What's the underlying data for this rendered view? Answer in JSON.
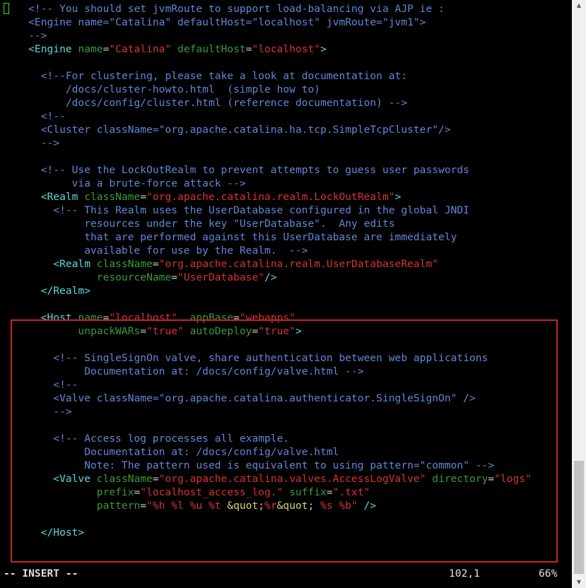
{
  "editor": {
    "lines": [
      [
        {
          "t": "    <!-- You should set jvmRoute to support load-balancing via AJP ie :",
          "c": "comment"
        }
      ],
      [
        {
          "t": "    <Engine name=\"Catalina\" defaultHost=\"localhost\" jvmRoute=\"jvm1\">",
          "c": "comment"
        }
      ],
      [
        {
          "t": "    -->",
          "c": "comment"
        }
      ],
      [
        {
          "t": "    <Engine",
          "c": "tag"
        },
        {
          "t": " name",
          "c": "attr"
        },
        {
          "t": "=",
          "c": "plain"
        },
        {
          "t": "\"Catalina\"",
          "c": "str"
        },
        {
          "t": " defaultHost",
          "c": "attr"
        },
        {
          "t": "=",
          "c": "plain"
        },
        {
          "t": "\"localhost\"",
          "c": "str"
        },
        {
          "t": ">",
          "c": "tag"
        }
      ],
      [
        {
          "t": "",
          "c": "plain"
        }
      ],
      [
        {
          "t": "      <!--For clustering, please take a look at documentation at:",
          "c": "comment"
        }
      ],
      [
        {
          "t": "          /docs/cluster-howto.html  (simple how to)",
          "c": "comment"
        }
      ],
      [
        {
          "t": "          /docs/config/cluster.html (reference documentation) -->",
          "c": "comment"
        }
      ],
      [
        {
          "t": "      <!--",
          "c": "comment"
        }
      ],
      [
        {
          "t": "      <Cluster className=\"org.apache.catalina.ha.tcp.SimpleTcpCluster\"/>",
          "c": "comment"
        }
      ],
      [
        {
          "t": "      -->",
          "c": "comment"
        }
      ],
      [
        {
          "t": "",
          "c": "plain"
        }
      ],
      [
        {
          "t": "      <!-- Use the LockOutRealm to prevent attempts to guess user passwords",
          "c": "comment"
        }
      ],
      [
        {
          "t": "           via a brute-force attack -->",
          "c": "comment"
        }
      ],
      [
        {
          "t": "      <Realm",
          "c": "tag"
        },
        {
          "t": " className",
          "c": "attr"
        },
        {
          "t": "=",
          "c": "plain"
        },
        {
          "t": "\"org.apache.catalina.realm.LockOutRealm\"",
          "c": "str"
        },
        {
          "t": ">",
          "c": "tag"
        }
      ],
      [
        {
          "t": "        <!-- This Realm uses the UserDatabase configured in the global JNDI",
          "c": "comment"
        }
      ],
      [
        {
          "t": "             resources under the key \"UserDatabase\".  Any edits",
          "c": "comment"
        }
      ],
      [
        {
          "t": "             that are performed against this UserDatabase are immediately",
          "c": "comment"
        }
      ],
      [
        {
          "t": "             available for use by the Realm.  -->",
          "c": "comment"
        }
      ],
      [
        {
          "t": "        <Realm",
          "c": "tag"
        },
        {
          "t": " className",
          "c": "attr"
        },
        {
          "t": "=",
          "c": "plain"
        },
        {
          "t": "\"org.apache.catalina.realm.UserDatabaseRealm\"",
          "c": "str"
        }
      ],
      [
        {
          "t": "               resourceName",
          "c": "attr"
        },
        {
          "t": "=",
          "c": "plain"
        },
        {
          "t": "\"UserDatabase\"",
          "c": "str"
        },
        {
          "t": "/>",
          "c": "tag"
        }
      ],
      [
        {
          "t": "      </Realm>",
          "c": "tag"
        }
      ],
      [
        {
          "t": "",
          "c": "plain"
        }
      ],
      [
        {
          "t": "      <Host",
          "c": "tag"
        },
        {
          "t": " name",
          "c": "attr"
        },
        {
          "t": "=",
          "c": "plain"
        },
        {
          "t": "\"localhost\"",
          "c": "str"
        },
        {
          "t": "  appBase",
          "c": "attr"
        },
        {
          "t": "=",
          "c": "plain"
        },
        {
          "t": "\"webapps\"",
          "c": "str"
        }
      ],
      [
        {
          "t": "            unpackWARs",
          "c": "attr"
        },
        {
          "t": "=",
          "c": "plain"
        },
        {
          "t": "\"true\"",
          "c": "str"
        },
        {
          "t": " autoDeploy",
          "c": "attr"
        },
        {
          "t": "=",
          "c": "plain"
        },
        {
          "t": "\"true\"",
          "c": "str"
        },
        {
          "t": ">",
          "c": "tag"
        }
      ],
      [
        {
          "t": "",
          "c": "plain"
        }
      ],
      [
        {
          "t": "        <!-- SingleSignOn valve, share authentication between web applications",
          "c": "comment"
        }
      ],
      [
        {
          "t": "             Documentation at: /docs/config/valve.html -->",
          "c": "comment"
        }
      ],
      [
        {
          "t": "        <!--",
          "c": "comment"
        }
      ],
      [
        {
          "t": "        <Valve className=\"org.apache.catalina.authenticator.SingleSignOn\" />",
          "c": "comment"
        }
      ],
      [
        {
          "t": "        -->",
          "c": "comment"
        }
      ],
      [
        {
          "t": "",
          "c": "plain"
        }
      ],
      [
        {
          "t": "        <!-- Access log processes all example.",
          "c": "comment"
        }
      ],
      [
        {
          "t": "             Documentation at: /docs/config/valve.html",
          "c": "comment"
        }
      ],
      [
        {
          "t": "             Note: The pattern used is equivalent to using pattern=\"common\" -->",
          "c": "comment"
        }
      ],
      [
        {
          "t": "        <Valve",
          "c": "tag"
        },
        {
          "t": " className",
          "c": "attr"
        },
        {
          "t": "=",
          "c": "plain"
        },
        {
          "t": "\"org.apache.catalina.valves.AccessLogValve\"",
          "c": "str"
        },
        {
          "t": " directory",
          "c": "attr"
        },
        {
          "t": "=",
          "c": "plain"
        },
        {
          "t": "\"logs\"",
          "c": "str"
        }
      ],
      [
        {
          "t": "               prefix",
          "c": "attr"
        },
        {
          "t": "=",
          "c": "plain"
        },
        {
          "t": "\"localhost_access_log.\"",
          "c": "str"
        },
        {
          "t": " suffix",
          "c": "attr"
        },
        {
          "t": "=",
          "c": "plain"
        },
        {
          "t": "\".txt\"",
          "c": "str"
        }
      ],
      [
        {
          "t": "               pattern",
          "c": "attr"
        },
        {
          "t": "=",
          "c": "plain"
        },
        {
          "t": "\"%h %l %u %t ",
          "c": "str"
        },
        {
          "t": "&quot;",
          "c": "ent"
        },
        {
          "t": "%r",
          "c": "str"
        },
        {
          "t": "&quot;",
          "c": "ent"
        },
        {
          "t": " %s %b\"",
          "c": "str"
        },
        {
          "t": " />",
          "c": "tag"
        }
      ],
      [
        {
          "t": "",
          "c": "plain"
        }
      ],
      [
        {
          "t": "      </Host>",
          "c": "tag"
        }
      ]
    ]
  },
  "status": {
    "mode": "-- INSERT --",
    "position": "102,1",
    "percent": "66%"
  },
  "colors": {
    "background": "#000000",
    "comment": "#5f87d7",
    "tag": "#5fd7d7",
    "attribute": "#3a9a3a",
    "string": "#d73232",
    "entity": "#d7d75f",
    "cursor": "#33dd33",
    "highlight_box": "#cc2222"
  },
  "scrollbar": {
    "up_icon": "triangle-up-icon",
    "down_icon": "triangle-down-icon",
    "up_glyph": "▲",
    "down_glyph": "▼"
  }
}
